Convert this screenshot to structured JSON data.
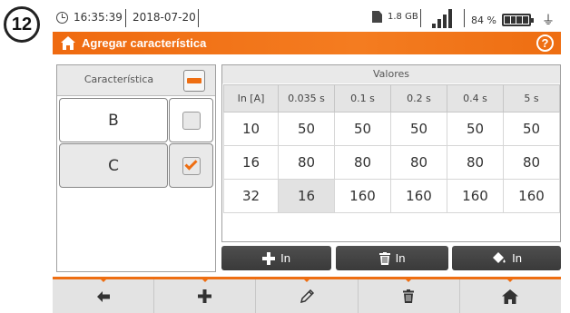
{
  "step_badge": "12",
  "status": {
    "time": "16:35:39",
    "date": "2018-07-20",
    "storage": "1.8 GB",
    "battery": "84 %"
  },
  "title_bar": {
    "title": "Agregar característica",
    "help_label": "?"
  },
  "left_panel": {
    "header": "Característica",
    "rows": [
      {
        "label": "B",
        "checked": false
      },
      {
        "label": "C",
        "checked": true
      }
    ]
  },
  "values_panel": {
    "header": "Valores",
    "columns": [
      "In [A]",
      "0.035 s",
      "0.1 s",
      "0.2 s",
      "0.4 s",
      "5 s"
    ],
    "rows": [
      [
        "10",
        "50",
        "50",
        "50",
        "50",
        "50"
      ],
      [
        "16",
        "80",
        "80",
        "80",
        "80",
        "80"
      ],
      [
        "32",
        "16",
        "160",
        "160",
        "160",
        "160"
      ]
    ]
  },
  "actions": {
    "add_label": "In",
    "delete_label": "In",
    "fill_label": "In"
  },
  "bottom_nav": [
    "back-arrow-icon",
    "plus-icon",
    "pencil-icon",
    "trash-icon",
    "home-icon"
  ],
  "colors": {
    "accent": "#ee6e12",
    "dark_button": "#3f3f3f"
  }
}
